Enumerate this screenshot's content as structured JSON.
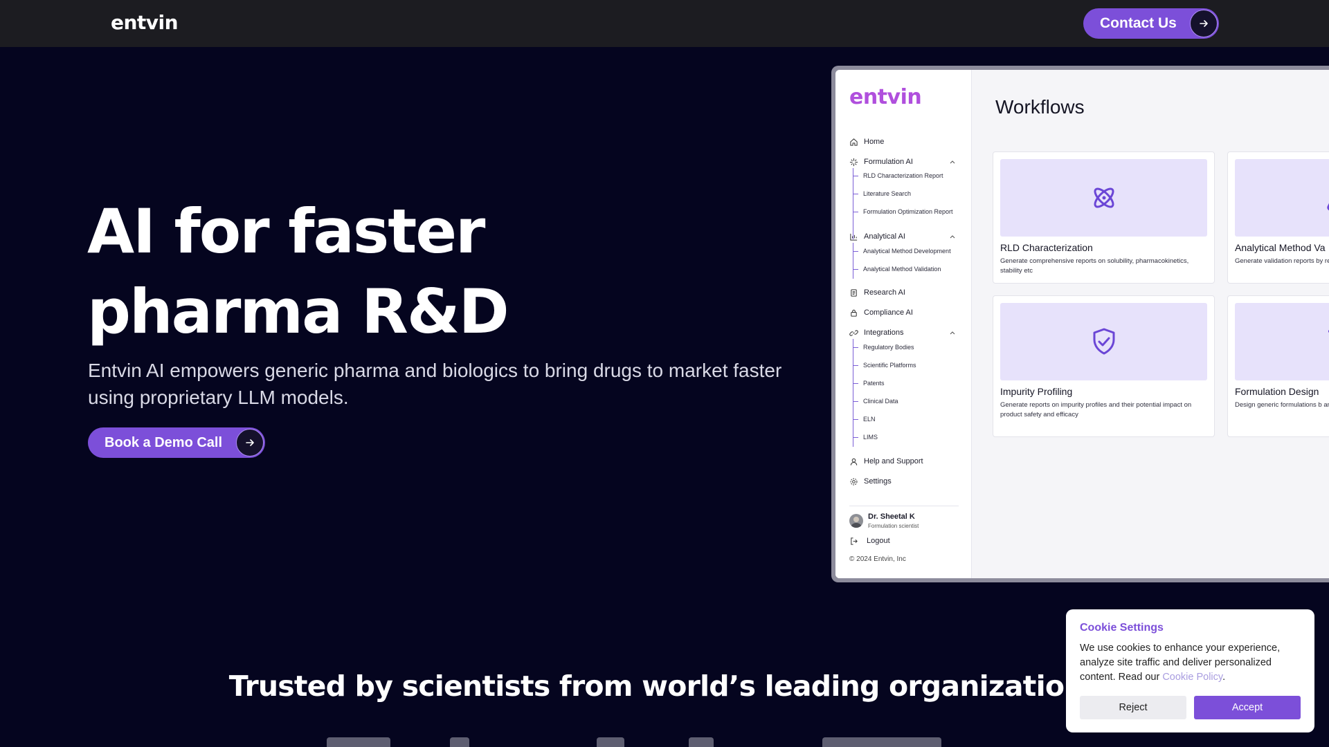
{
  "nav": {
    "logo": "entvin",
    "contact_label": "Contact Us"
  },
  "hero": {
    "title_line1": "AI for faster",
    "title_line2": "pharma R&D",
    "subtitle": "Entvin AI empowers generic pharma and biologics to bring drugs to market faster using proprietary LLM models.",
    "demo_label": "Book a Demo Call"
  },
  "mock": {
    "logo": "entvin",
    "title": "Workflows",
    "nav": {
      "home": "Home",
      "formulation_ai": "Formulation AI",
      "formulation_sub": [
        "RLD Characterization Report",
        "Literature Search",
        "Formulation Optimization Report"
      ],
      "analytical_ai": "Analytical AI",
      "analytical_sub": [
        "Analytical Method Development",
        "Analytical Method Validation"
      ],
      "research_ai": "Research AI",
      "compliance_ai": "Compliance AI",
      "integrations": "Integrations",
      "integrations_sub": [
        "Regulatory Bodies",
        "Scientific Platforms",
        "Patents",
        "Clinical Data",
        "ELN",
        "LIMS"
      ],
      "help": "Help and Support",
      "settings": "Settings"
    },
    "user": {
      "name": "Dr. Sheetal K",
      "role": "Formulation scientist",
      "logout": "Logout"
    },
    "copyright": "© 2024 Entvin, Inc",
    "cards": [
      {
        "title": "RLD Characterization",
        "desc": "Generate comprehensive reports on solubility, pharmacokinetics, stability etc",
        "icon": "atom-icon"
      },
      {
        "title": "Analytical Method Va",
        "desc": "Generate validation reports by reporting",
        "icon": "flask-icon"
      },
      {
        "title": "Impurity Profiling",
        "desc": "Generate reports on impurity profiles and their potential impact on product safety and efficacy",
        "icon": "shield-check-icon"
      },
      {
        "title": "Formulation Design",
        "desc": "Design generic formulations b and dosage forms. Optimize f strategies.",
        "icon": "beaker-icon"
      }
    ]
  },
  "cookie": {
    "title": "Cookie Settings",
    "text": "We use cookies to enhance your experience, analyze site traffic and deliver personalized content. Read our",
    "link": "Cookie Policy",
    "period": ".",
    "reject": "Reject",
    "accept": "Accept"
  },
  "trusted": "Trusted by scientists from world’s leading organizations",
  "colors": {
    "accent": "#7c4fd9",
    "background": "#05051f",
    "nav": "#1c1c21",
    "mock_logo": "#b04fdd"
  }
}
